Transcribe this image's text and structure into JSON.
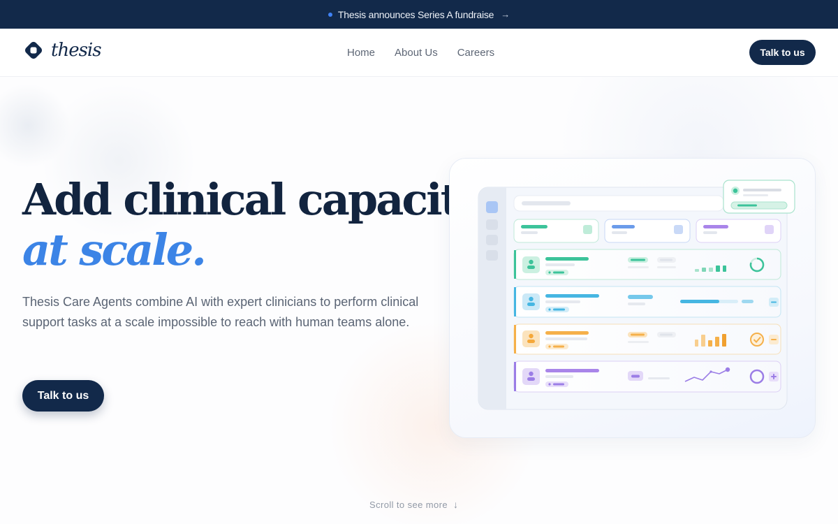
{
  "banner": {
    "text": "Thesis announces Series A fundraise",
    "arrow": "→"
  },
  "brand": {
    "name": "thesis",
    "icon": "thesis-logo-icon"
  },
  "nav": {
    "links": [
      "Home",
      "About Us",
      "Careers"
    ],
    "cta": "Talk to us"
  },
  "hero": {
    "headline_line1": "Add clinical capacity",
    "headline_line2": "at scale.",
    "description": "Thesis Care Agents combine AI with expert clinicians to perform clinical support tasks at a scale impossible to reach with human teams alone.",
    "cta": "Talk to us"
  },
  "scroll_hint": {
    "text": "Scroll to see more",
    "icon": "arrow-down-icon"
  },
  "colors": {
    "navy": "#12294a",
    "accent_blue": "#3c84e6",
    "green": "#3cc39a",
    "sky": "#46b6e2",
    "orange": "#f5b04a",
    "purple": "#9b7de6"
  }
}
